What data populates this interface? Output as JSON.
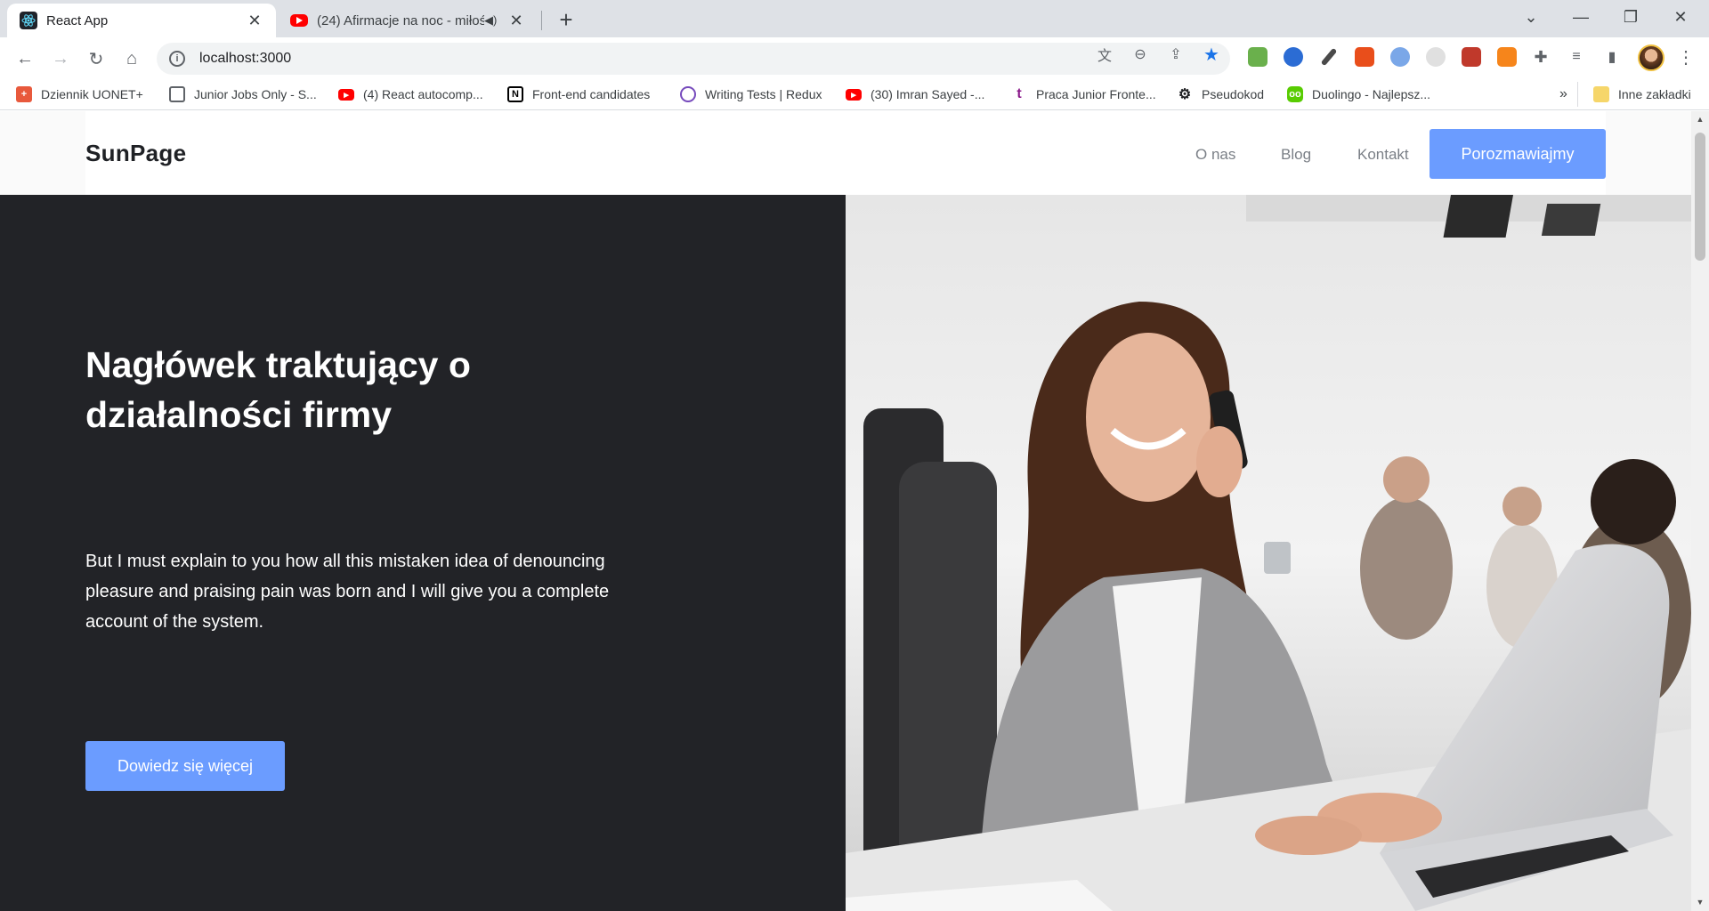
{
  "browser": {
    "tabs": [
      {
        "title": "React App",
        "icon": "react-icon",
        "active": true
      },
      {
        "title": "(24) Afirmacje na noc - miłoś",
        "icon": "youtube-icon",
        "active": false
      }
    ],
    "url": "localhost:3000",
    "bookmarks": [
      {
        "label": "Dziennik UONET+",
        "icon": "uonet-icon",
        "color": "#e8593c"
      },
      {
        "label": "Junior Jobs Only - S...",
        "icon": "mail-icon",
        "color": "#5f6368"
      },
      {
        "label": "(4) React autocomp...",
        "icon": "youtube-icon",
        "color": "#ff0000"
      },
      {
        "label": "Front-end candidates",
        "icon": "notion-icon",
        "color": "#000000"
      },
      {
        "label": "Writing Tests | Redux",
        "icon": "redux-icon",
        "color": "#764abc"
      },
      {
        "label": "(30) Imran Sayed -...",
        "icon": "youtube-icon",
        "color": "#ff0000"
      },
      {
        "label": "Praca Junior Fronte...",
        "icon": "theprotocol-icon",
        "color": "#8b1a8b"
      },
      {
        "label": "Pseudokod",
        "icon": "gear-icon",
        "color": "#202124"
      },
      {
        "label": "Duolingo - Najlepsz...",
        "icon": "duolingo-icon",
        "color": "#58cc02"
      }
    ],
    "overflow_label": "»",
    "other_bookmarks": "Inne zakładki"
  },
  "site": {
    "logo": "SunPage",
    "nav": [
      "O nas",
      "Blog",
      "Kontakt"
    ],
    "cta": "Porozmawiajmy",
    "colors": {
      "accent": "#6b9cff",
      "hero_bg": "#222327"
    }
  },
  "hero": {
    "title": "Nagłówek traktujący o działalności firmy",
    "text": "But I must explain to you how all this mistaken idea of denouncing pleasure and praising pain was born and I will give you a complete account of the system.",
    "button": "Dowiedz się więcej",
    "image": "woman-on-phone-at-laptop-photo"
  }
}
